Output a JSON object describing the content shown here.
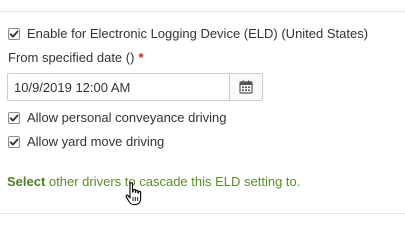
{
  "eld_setting": {
    "enable_label": "Enable for Electronic Logging Device (ELD) (United States)",
    "enable_checked": true,
    "from_date_label": "From specified date ()",
    "required_marker": "*",
    "date_value": "10/9/2019 12:00 AM",
    "calendar_icon": "calendar-icon",
    "personal_conveyance_label": "Allow personal conveyance driving",
    "personal_conveyance_checked": true,
    "yard_move_label": "Allow yard move driving",
    "yard_move_checked": true
  },
  "cascade": {
    "link_label": "Select",
    "rest_text": " other drivers to cascade this ELD setting to."
  },
  "colors": {
    "required": "#d0231f",
    "cascade_text": "#5b8b2e",
    "cascade_link": "#4f7f24"
  },
  "cursor_icon": "hand-pointer-icon"
}
